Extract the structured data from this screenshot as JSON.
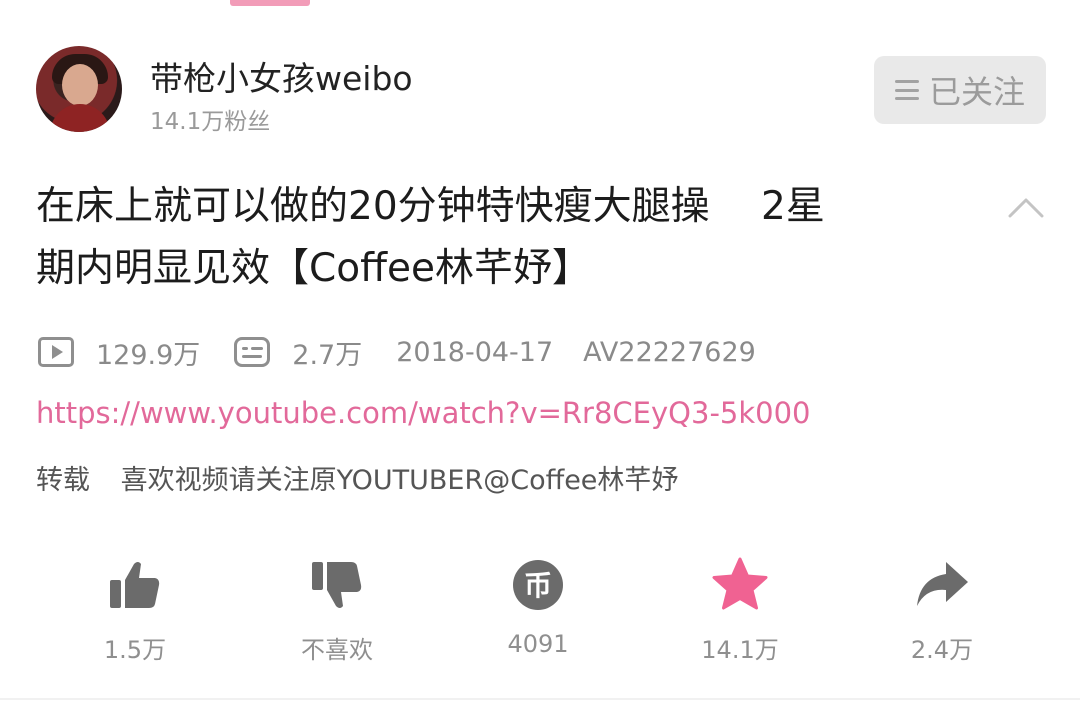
{
  "uploader": {
    "name": "带枪小女孩weibo",
    "fans": "14.1万粉丝",
    "follow_label": "已关注"
  },
  "video": {
    "title_line1": "在床上就可以做的20分钟特快瘦大腿操　 2星",
    "title_line2": "期内明显见效【Coffee林芊妤】",
    "views": "129.9万",
    "danmaku": "2.7万",
    "date": "2018-04-17",
    "av_id": "AV22227629",
    "source_link": "https://www.youtube.com/watch?v=Rr8CEyQ3-5k000",
    "repost_tag": "转载",
    "description": "喜欢视频请关注原YOUTUBER@Coffee林芊妤"
  },
  "actions": {
    "like": "1.5万",
    "dislike": "不喜欢",
    "coin": "4091",
    "favorite": "14.1万",
    "share": "2.4万"
  },
  "colors": {
    "accent_pink": "#e2699a",
    "favorite_pink": "#f06292",
    "icon_gray": "#8f8f8f"
  }
}
